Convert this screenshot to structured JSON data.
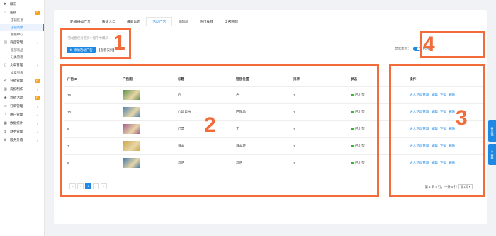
{
  "sidebar": {
    "items": [
      {
        "icon": "✖",
        "label": "概况",
        "arrow": "",
        "badge": ""
      },
      {
        "icon": "⌂",
        "label": "店铺",
        "arrow": "˄",
        "badge": "P",
        "subs": [
          {
            "label": "店铺信息",
            "active": false
          },
          {
            "label": "店铺装修",
            "active": true
          },
          {
            "label": "客服中心",
            "active": false
          }
        ]
      },
      {
        "icon": "▤",
        "label": "商品管理",
        "arrow": "˄",
        "badge": "",
        "subs": [
          {
            "label": "全部商品",
            "active": false
          },
          {
            "label": "分类管理",
            "active": false
          }
        ]
      },
      {
        "icon": "▯",
        "label": "文章管理",
        "arrow": "˄",
        "badge": "",
        "subs": [
          {
            "label": "文章列表",
            "active": false
          }
        ]
      },
      {
        "icon": "⋖",
        "label": "分销管理",
        "arrow": "",
        "badge": "P"
      },
      {
        "icon": "▥",
        "label": "海报制作",
        "arrow": "˅",
        "badge": ""
      },
      {
        "icon": "◈",
        "label": "营销活动",
        "arrow": "",
        "badge": "P"
      },
      {
        "icon": "▭",
        "label": "订单管理",
        "arrow": "˅",
        "badge": ""
      },
      {
        "icon": "◔",
        "label": "用户管理",
        "arrow": "˅",
        "badge": ""
      },
      {
        "icon": "▦",
        "label": "数据统计",
        "arrow": "˅",
        "badge": ""
      },
      {
        "icon": "$",
        "label": "财务管理",
        "arrow": "˅",
        "badge": ""
      },
      {
        "icon": "⚙",
        "label": "服务升级",
        "arrow": "˅",
        "badge": ""
      }
    ]
  },
  "tabs": [
    {
      "label": "轮播横幅广告",
      "active": false
    },
    {
      "label": "快捷入口",
      "active": false
    },
    {
      "label": "最新动态",
      "active": false
    },
    {
      "label": "活动广告",
      "active": true
    },
    {
      "label": "目的地",
      "active": false
    },
    {
      "label": "热门推荐",
      "active": false
    },
    {
      "label": "全部管理",
      "active": false
    }
  ],
  "hint": "*活动都仅对首页小程序中模块",
  "add_button": "添加活动广告",
  "example_link": "【查看实例】",
  "status": {
    "label": "显示状态：",
    "value": "已开启"
  },
  "table": {
    "headers": [
      "广告ID",
      "广告图",
      "标题",
      "链接位置",
      "排序",
      "状态",
      "操作"
    ],
    "rows": [
      {
        "id": "16",
        "title": "的",
        "link": "色",
        "sort": "1",
        "status": "已上架",
        "thumb": "#5a8f4a"
      },
      {
        "id": "10",
        "title": "心动自由",
        "link": "巴厘岛",
        "sort": "1",
        "status": "已上架",
        "thumb": "#4a7fb0"
      },
      {
        "id": "8",
        "title": "门票",
        "link": "无",
        "sort": "1",
        "status": "已上架",
        "thumb": "#a05a8a"
      },
      {
        "id": "7",
        "title": "日本",
        "link": "日本游",
        "sort": "1",
        "status": "已上架",
        "thumb": "#c9a44a"
      },
      {
        "id": "6",
        "title": "酒店",
        "link": "酒店",
        "sort": "1",
        "status": "已上架",
        "thumb": "#3d78a8"
      }
    ],
    "ops": [
      "进入活动管理",
      "编辑",
      "下架",
      "删除"
    ]
  },
  "pager": {
    "pages": [
      "«",
      "‹",
      "1",
      "›",
      "»"
    ],
    "current": "1"
  },
  "page_info": {
    "text": "第 1 到 5 行，一共 5 行",
    "select": "第1页"
  },
  "float_buttons": [
    "店铺",
    "客服"
  ],
  "annotations": [
    "1",
    "2",
    "3",
    "4"
  ]
}
